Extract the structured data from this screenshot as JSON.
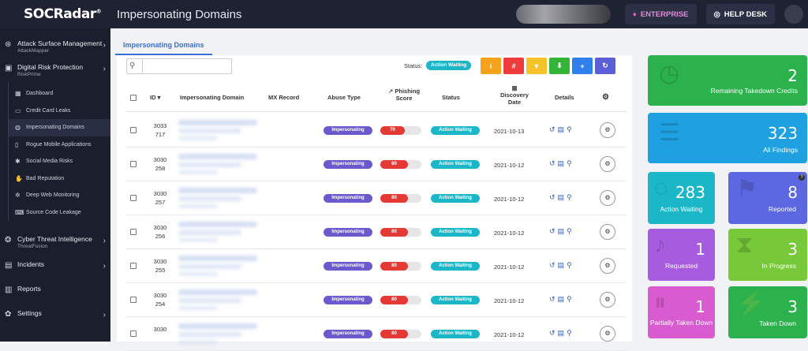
{
  "header": {
    "logo_text": "SOCRadar",
    "logo_registered": "®",
    "title": "Impersonating Domains",
    "enterprise_label": "ENTERPRISE",
    "helpdesk_label": "HELP DESK"
  },
  "sidebar": {
    "groups": [
      {
        "title": "Attack Surface Management",
        "subtitle": "AttackMapper"
      },
      {
        "title": "Digital Risk Protection",
        "subtitle": "RiskPrime"
      },
      {
        "title": "Cyber Threat Intelligence",
        "subtitle": "ThreatFusion"
      },
      {
        "title": "Incidents",
        "subtitle": ""
      },
      {
        "title": "Reports",
        "subtitle": ""
      },
      {
        "title": "Settings",
        "subtitle": ""
      }
    ],
    "items": [
      {
        "label": "Dashboard"
      },
      {
        "label": "Credit Card Leaks"
      },
      {
        "label": "Impersonating Domains"
      },
      {
        "label": "Rogue Mobile Applications"
      },
      {
        "label": "Social Media Risks"
      },
      {
        "label": "Bad Reputation"
      },
      {
        "label": "Deep Web Monitoring"
      },
      {
        "label": "Source Code Leakage"
      }
    ]
  },
  "tabs": [
    {
      "label": "Impersonating Domains"
    }
  ],
  "toolbar": {
    "status_label": "Status:",
    "status_value": "Action Waiting",
    "buttons": [
      {
        "icon": "info-icon",
        "glyph": "i",
        "color": "#f7a21b"
      },
      {
        "icon": "hash-icon",
        "glyph": "#",
        "color": "#ef3b3b"
      },
      {
        "icon": "filter-icon",
        "glyph": "▼",
        "color": "#f7c32b"
      },
      {
        "icon": "download-icon",
        "glyph": "⬇",
        "color": "#34b53a"
      },
      {
        "icon": "plus-icon",
        "glyph": "+",
        "color": "#2f80ed"
      },
      {
        "icon": "refresh-icon",
        "glyph": "↻",
        "color": "#5b5fd6"
      }
    ]
  },
  "table": {
    "headers": {
      "id": "ID",
      "domain": "Impersonating Domain",
      "mx": "MX Record",
      "abuse": "Abuse Type",
      "phishing_line1": "Phishing",
      "phishing_line2": "Score",
      "status": "Status",
      "discovery_line1": "Discovery",
      "discovery_line2": "Date",
      "details": "Details"
    },
    "rows": [
      {
        "id1": "3033",
        "id2": "717",
        "abuse": "Impersonating",
        "score": 70,
        "status": "Action Waiting",
        "date": "2021-10-13"
      },
      {
        "id1": "3030",
        "id2": "258",
        "abuse": "Impersonating",
        "score": 80,
        "status": "Action Waiting",
        "date": "2021-10-12"
      },
      {
        "id1": "3030",
        "id2": "257",
        "abuse": "Impersonating",
        "score": 80,
        "status": "Action Waiting",
        "date": "2021-10-12"
      },
      {
        "id1": "3030",
        "id2": "256",
        "abuse": "Impersonating",
        "score": 80,
        "status": "Action Waiting",
        "date": "2021-10-12"
      },
      {
        "id1": "3030",
        "id2": "255",
        "abuse": "Impersonating",
        "score": 80,
        "status": "Action Waiting",
        "date": "2021-10-12"
      },
      {
        "id1": "3030",
        "id2": "254",
        "abuse": "Impersonating",
        "score": 80,
        "status": "Action Waiting",
        "date": "2021-10-12"
      },
      {
        "id1": "3030",
        "id2": "",
        "abuse": "Impersonating",
        "score": 80,
        "status": "Action Waiting",
        "date": "2021-10-12"
      }
    ]
  },
  "stats": {
    "remaining": {
      "value": "2",
      "label": "Remaining Takedown Credits",
      "color": "#2bb24c"
    },
    "all": {
      "value": "323",
      "label": "All Findings",
      "color": "#1fa0e0"
    },
    "action_waiting": {
      "value": "283",
      "label": "Action Waiting",
      "color": "#1cb6c9"
    },
    "reported": {
      "value": "8",
      "label": "Reported",
      "color": "#5c68e2"
    },
    "requested": {
      "value": "1",
      "label": "Requested",
      "color": "#a75ce0"
    },
    "in_progress": {
      "value": "3",
      "label": "In Progress",
      "color": "#77c93a"
    },
    "partially": {
      "value": "1",
      "label": "Partially Taken Down",
      "color": "#d85ccf"
    },
    "taken_down": {
      "value": "3",
      "label": "Taken Down",
      "color": "#2bb24c"
    }
  }
}
